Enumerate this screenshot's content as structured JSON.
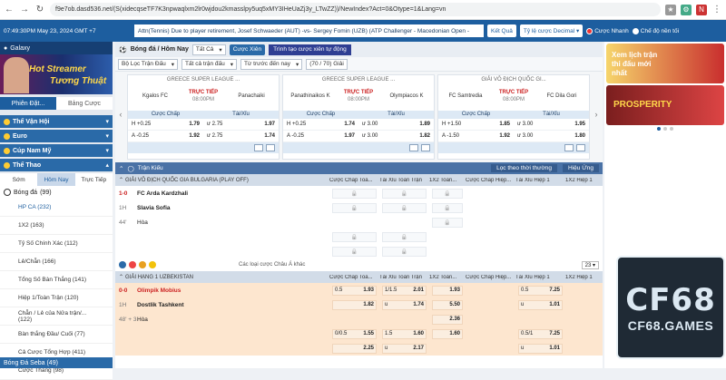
{
  "browser": {
    "url": "f9e7ob.dasd536.net/(S(xidecqseTF7K3npwaqlxm2lr0wjdou2kmasslpy5uq5xMY3IHeUaZj3y_LTwZZ))/NewIndex?Act=0&Otype=1&Lang=vn"
  },
  "topbar": {
    "time": "07:49:30PM May 23, 2024 GMT +7",
    "ticker": "Attn(Tennis) Due to player retirement, Josef Schwaeder (AUT) -vs- Sergey Fomin (UZB) (ATP Challenger - Macedonian Open -",
    "btn_result": "Kết Quả",
    "odds_type": "Tỷ lệ cược Decimal",
    "quick_bet": "Cược Nhanh",
    "light_mode": "Chế độ nền tối"
  },
  "left": {
    "galaxy": "Galaxy",
    "banner_line1": "Hot Streamer",
    "banner_line2": "Tương Thuật",
    "tab_session": "Phiên Đặt...",
    "tab_table": "Bảng Cược",
    "menu": [
      "Thể Vận Hội",
      "Euro",
      "Cúp Nam Mỹ",
      "Thể Thao"
    ],
    "subtabs": [
      "Sớm",
      "Hôm Nay",
      "Trực Tiếp"
    ],
    "sport": "Bóng đá",
    "sport_count": "(99)",
    "items": [
      "HP CA (232)",
      "1X2 (163)",
      "Tỷ Số Chính Xác (112)",
      "Lẻ/Chẵn (166)",
      "Tổng Số Bàn Thắng (141)",
      "Hiệp 1/Toàn Trận (120)",
      "Chẵn / Lẻ của Nửa trận/... (122)",
      "Bàn thắng Đầu/ Cuối (77)",
      "Cả Cược Tổng Hợp (411)",
      "Cược Thắng (98)"
    ],
    "bottom": "Bóng Đá Seba (49)"
  },
  "main": {
    "title": "Bóng đá / Hôm Nay",
    "select_all": "Tất Cả",
    "bet_button": "Cược Xiên",
    "auto_order": "Trình tạo cược xiên tự động",
    "filter_league": "Bộ Lọc Trận Đấu",
    "filter_all": "Tất cả trận đấu",
    "filter_time": "Từ trước đến nay",
    "filter_count": "(70 / 70) Giải",
    "featured": [
      {
        "league": "GREECE SUPER LEAGUE ...",
        "home": "Kgalos FC",
        "away": "Panachaiki",
        "live": "TRỰC TIẾP",
        "time": "08:00PM",
        "h_line": "H +0.25",
        "h_odd": "1.79",
        "a_line": "A -0.25",
        "a_odd": "1.92",
        "o_line": "ư 2.75",
        "o_odd": "1.97",
        "u_line": "ư 2.75",
        "u_odd": "1.74"
      },
      {
        "league": "GREECE SUPER LEAGUE ...",
        "home": "Panathinaikos K",
        "away": "Olympiacos K",
        "live": "TRỰC TIẾP",
        "time": "08:00PM",
        "h_line": "H +0.25",
        "h_odd": "1.74",
        "a_line": "A -0.25",
        "a_odd": "1.97",
        "o_line": "ư 3.00",
        "o_odd": "1.89",
        "u_line": "ư 3.00",
        "u_odd": "1.82"
      },
      {
        "league": "GIẢI VÔ ĐỊCH QUỐC GI...",
        "home": "FC Samtredia",
        "away": "FC Dila Gori",
        "live": "TRỰC TIẾP",
        "time": "08:00PM",
        "h_line": "H +1.50",
        "h_odd": "1.85",
        "a_line": "A -1.50",
        "a_odd": "1.92",
        "o_line": "ư 3.00",
        "o_odd": "1.95",
        "u_line": "ư 3.00",
        "u_odd": "1.80"
      }
    ],
    "featured_hdr_odds": "Cược Chấp",
    "featured_hdr_ou": "Tài/Xỉu",
    "live_label": "Trận Kiếu",
    "sort_label": "Lọc theo thời thường",
    "sort_display": "Hiệu Ứng",
    "col_headers": [
      "Cược Chấp Toà...",
      "Tài Xỉu Toàn Trận",
      "1X2 Toàn...",
      "Cược Chấp Hiệp...",
      "Tài Xỉu Hiệp 1",
      "1X2 Hiệp 1"
    ],
    "league1": "GIẢI VÔ ĐỊCH QUỐC GIA BULGARIA (PLAY OFF)",
    "match1": {
      "score": "1-0",
      "time": "1H",
      "min": "44'",
      "home": "FC Arda Kardzhali",
      "away": "Slavia Sofia",
      "draw": "Hòa"
    },
    "more_label": "Các loại cược Châu Á khác",
    "page_num": "23",
    "league2": "GIẢI HẠNG 1 UZBEKISTAN",
    "match2": {
      "score": "0-0",
      "time": "1H",
      "min": "48' + 3",
      "home": "Olimpik Mobius",
      "away": "Dostlik Tashkent",
      "draw": "Hòa",
      "r1": [
        "0.5",
        "1.93",
        "1/1.5",
        "2.01",
        "1.93",
        "0.5",
        "7.25"
      ],
      "r2": [
        "",
        "1.82",
        "u",
        "1.74",
        "5.50",
        "u",
        "1.01"
      ],
      "r3": [
        "",
        "",
        "",
        "",
        "2.36",
        "",
        ""
      ],
      "r4": [
        "0/0.5",
        "1.55",
        "1.5",
        "1.60",
        "1.60",
        "0.5/1",
        "7.25"
      ],
      "r5": [
        "",
        "2.25",
        "u",
        "2.17",
        "",
        "u",
        "1.01"
      ]
    }
  },
  "right": {
    "ad1_text": "Xem lịch trận thi đấu mới nhất",
    "ad2_text": "PROSPERITY",
    "logo_main": "CF68",
    "logo_sub": "CF68.GAMES"
  }
}
